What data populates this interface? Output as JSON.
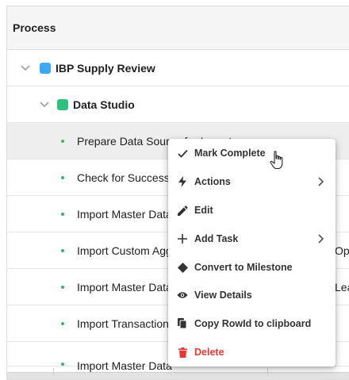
{
  "grid": {
    "header": "Process",
    "groups": [
      {
        "name": "IBP Supply Review",
        "color": "#3da9f5"
      },
      {
        "name": "Data Studio",
        "color": "#2ec27e"
      }
    ],
    "tasks": [
      {
        "label": "Prepare Data Source for Import",
        "tail": ""
      },
      {
        "label": "Check for Success",
        "tail": ""
      },
      {
        "label": "Import Master Data",
        "tail": ""
      },
      {
        "label": "Import Custom Agg",
        "tail": "Opt"
      },
      {
        "label": "Import Master Data",
        "tail": "Lea"
      },
      {
        "label": "Import Transaction",
        "tail": ""
      },
      {
        "label": "Import Master Data",
        "tail": ""
      }
    ]
  },
  "context_menu": {
    "items": [
      {
        "label": "Mark Complete",
        "icon": "check-icon",
        "submenu": false
      },
      {
        "label": "Actions",
        "icon": "lightning-icon",
        "submenu": true
      },
      {
        "label": "Edit",
        "icon": "pencil-icon",
        "submenu": false
      },
      {
        "label": "Add Task",
        "icon": "plus-icon",
        "submenu": true
      },
      {
        "label": "Convert to Milestone",
        "icon": "diamond-icon",
        "submenu": false
      },
      {
        "label": "View Details",
        "icon": "eye-icon",
        "submenu": false
      },
      {
        "label": "Copy RowId to clipboard",
        "icon": "copy-icon",
        "submenu": false
      },
      {
        "label": "Delete",
        "icon": "trash-icon",
        "submenu": false
      }
    ],
    "delete_color": "#e53935"
  }
}
